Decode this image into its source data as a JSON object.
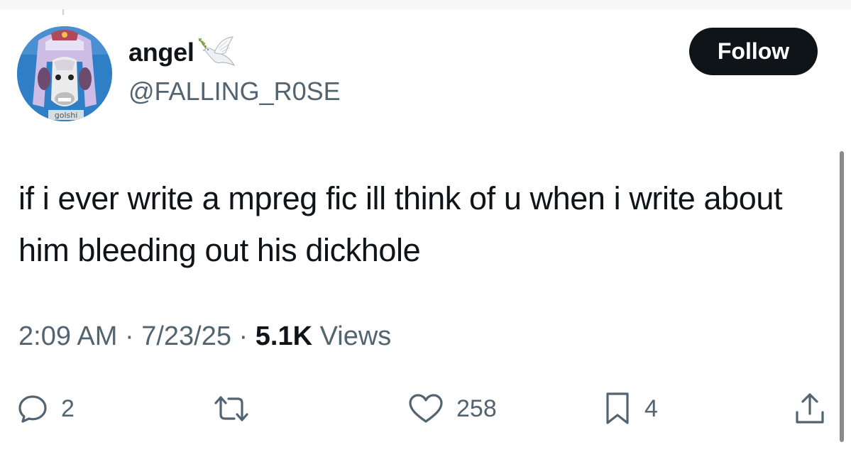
{
  "author": {
    "display_name": "angel",
    "handle": "@FALLING_R0SE",
    "avatar_caption": "golshi",
    "name_emoji": "dove-icon"
  },
  "follow_button": {
    "label": "Follow"
  },
  "tweet": {
    "text": "if i ever write a mpreg fic ill think of u when i write about him bleeding out his dickhole"
  },
  "meta": {
    "time": "2:09 AM",
    "separator": " · ",
    "date": "7/23/25",
    "views_count": "5.1K",
    "views_label": "Views"
  },
  "actions": {
    "reply": {
      "icon": "reply-bubble-icon",
      "count": "2"
    },
    "repost": {
      "icon": "repost-icon",
      "count": ""
    },
    "like": {
      "icon": "heart-icon",
      "count": "258"
    },
    "bookmark": {
      "icon": "bookmark-icon",
      "count": "4"
    },
    "share": {
      "icon": "share-upload-icon"
    }
  },
  "colors": {
    "text_primary": "#0f1419",
    "text_secondary": "#536471",
    "button_bg": "#0f1419",
    "button_text": "#ffffff",
    "avatar_bg": "#2f7fc6"
  }
}
